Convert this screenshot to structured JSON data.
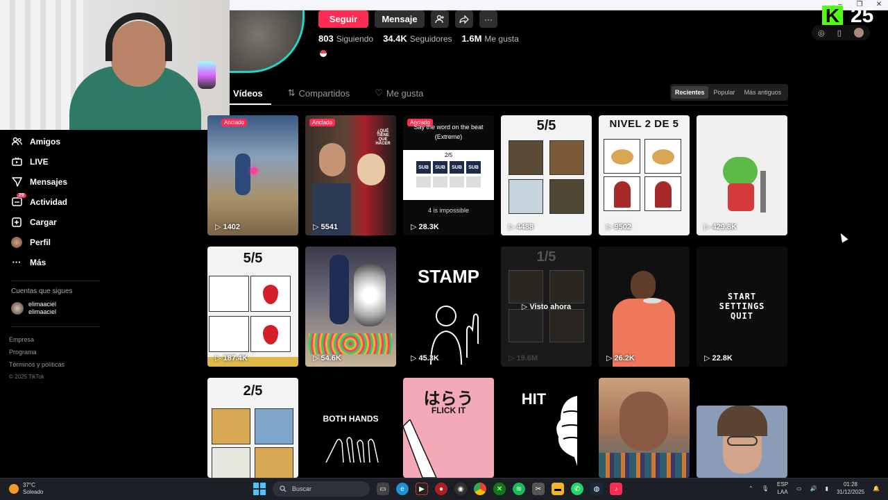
{
  "profile": {
    "follow_label": "Seguir",
    "message_label": "Mensaje",
    "stats": [
      {
        "value": "803",
        "label": "Siguiendo"
      },
      {
        "value": "34.4K",
        "label": "Seguidores"
      },
      {
        "value": "1.6M",
        "label": "Me gusta"
      }
    ]
  },
  "tabs": [
    {
      "label": "Vídeos",
      "active": true
    },
    {
      "label": "Compartidos",
      "active": false
    },
    {
      "label": "Me gusta",
      "active": false
    }
  ],
  "sort": [
    "Recientes",
    "Popular",
    "Más antiguos"
  ],
  "sidebar": {
    "items": [
      {
        "label": "Amigos",
        "icon": "friends-icon"
      },
      {
        "label": "LIVE",
        "icon": "live-icon"
      },
      {
        "label": "Mensajes",
        "icon": "messages-icon"
      },
      {
        "label": "Actividad",
        "icon": "activity-icon",
        "badge": "29"
      },
      {
        "label": "Cargar",
        "icon": "upload-icon"
      },
      {
        "label": "Perfil",
        "icon": "avatar"
      },
      {
        "label": "Más",
        "icon": "more-icon"
      }
    ],
    "following_title": "Cuentas que sigues",
    "following": [
      {
        "name": "elimaaciel",
        "handle": "elimaaciel"
      }
    ],
    "footer": [
      "Empresa",
      "Programa",
      "Términos y políticas"
    ],
    "copyright": "© 2025 TikTok"
  },
  "videos": [
    {
      "views": "1402",
      "pinned": "Anclado",
      "overlay": ""
    },
    {
      "views": "5541",
      "pinned": "Anclado",
      "overlay": "¿QUÉ TIENE QUE HACER"
    },
    {
      "views": "28.3K",
      "pinned": "Anclado",
      "overlay": "Say the word on the beat (Extreme)",
      "sub": "4 is impossible",
      "count": "2/5"
    },
    {
      "views": "4488",
      "overlay": "5/5"
    },
    {
      "views": "9502",
      "overlay": "NIVEL 2 DE 5"
    },
    {
      "views": "429.8K",
      "overlay": ""
    },
    {
      "views": "187.4K",
      "overlay": "5/5"
    },
    {
      "views": "54.6K",
      "overlay": ""
    },
    {
      "views": "45.3K",
      "overlay": "STAMP"
    },
    {
      "views": "19.6M",
      "overlay": "1/5",
      "seen": "Visto ahora"
    },
    {
      "views": "26.2K",
      "overlay": ""
    },
    {
      "views": "22.8K",
      "overlay": "START\nSETTINGS\nQUIT"
    },
    {
      "views": "",
      "overlay": "2/5"
    },
    {
      "views": "",
      "overlay": "BOTH HANDS"
    },
    {
      "views": "",
      "overlay": "はらう",
      "sub": "FLICK IT"
    },
    {
      "views": "",
      "overlay": "HIT"
    },
    {
      "views": "",
      "overlay": ""
    },
    {
      "views": "",
      "overlay": ""
    }
  ],
  "stream": {
    "kick_letter": "K",
    "number": "25"
  },
  "taskbar": {
    "temp": "37°C",
    "weather": "Soleado",
    "search_placeholder": "Buscar",
    "lang1": "ESP",
    "lang2": "LAA",
    "time": "01:28",
    "date": "31/12/2025"
  }
}
